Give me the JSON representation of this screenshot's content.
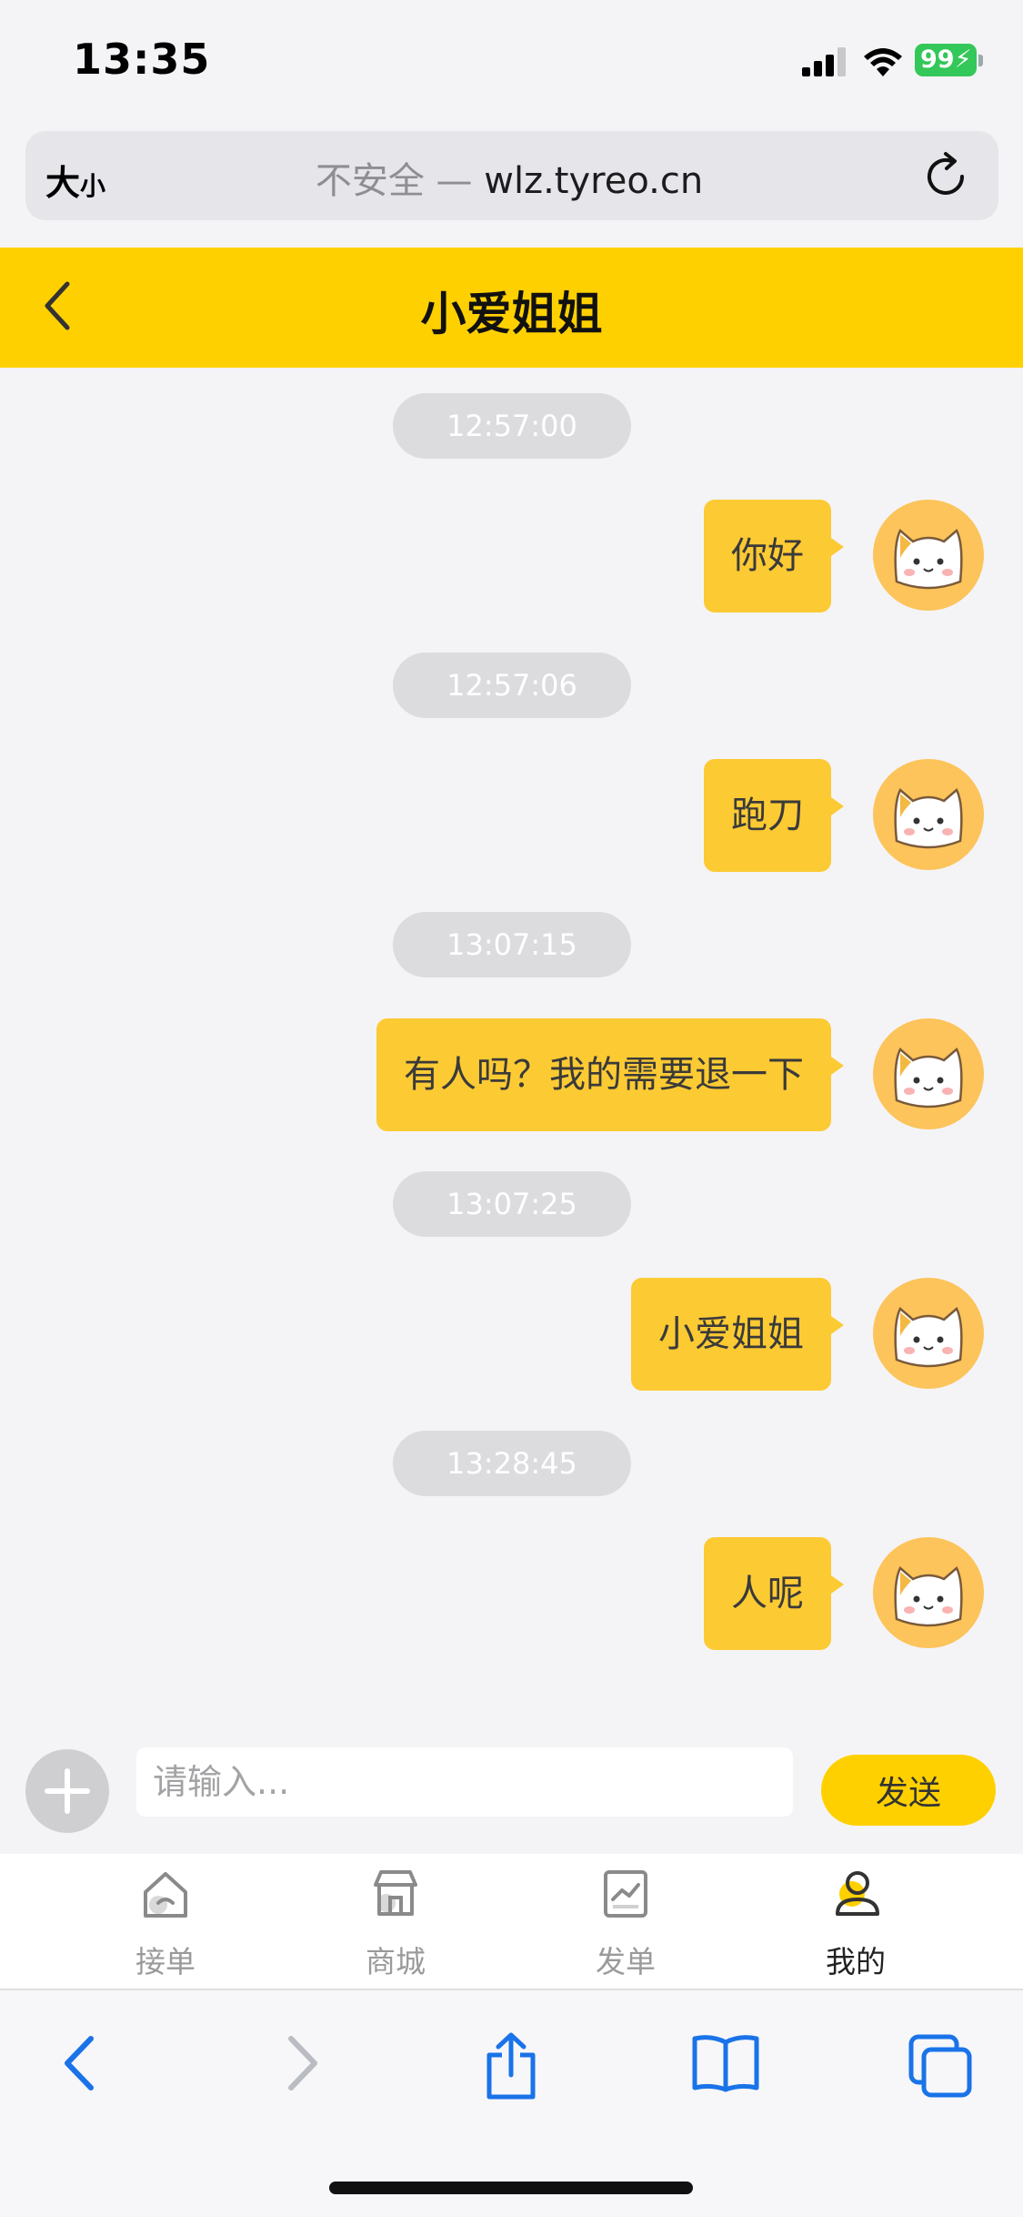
{
  "status_bar": {
    "time": "13:35",
    "battery": "99"
  },
  "browser": {
    "text_size": "大",
    "text_size_small": "小",
    "security_label": "不安全",
    "separator": " — ",
    "domain": "wlz.tyreo.cn"
  },
  "header": {
    "title": "小爱姐姐"
  },
  "messages": [
    {
      "time": "12:57:00",
      "text": "你好"
    },
    {
      "time": "12:57:06",
      "text": "跑刀"
    },
    {
      "time": "13:07:15",
      "text": "有人吗？我的需要退一下"
    },
    {
      "time": "13:07:25",
      "text": "小爱姐姐"
    },
    {
      "time": "13:28:45",
      "text": "人呢"
    }
  ],
  "input": {
    "placeholder": "请输入...",
    "send_label": "发送"
  },
  "tabs": [
    {
      "label": "接单",
      "icon": "home-icon"
    },
    {
      "label": "商城",
      "icon": "store-icon"
    },
    {
      "label": "发单",
      "icon": "chart-icon"
    },
    {
      "label": "我的",
      "icon": "user-icon",
      "active": true
    }
  ],
  "colors": {
    "accent": "#ffd000",
    "bubble": "#fcca33",
    "avatar": "#fcc45a",
    "safari_blue": "#1a73e8"
  }
}
